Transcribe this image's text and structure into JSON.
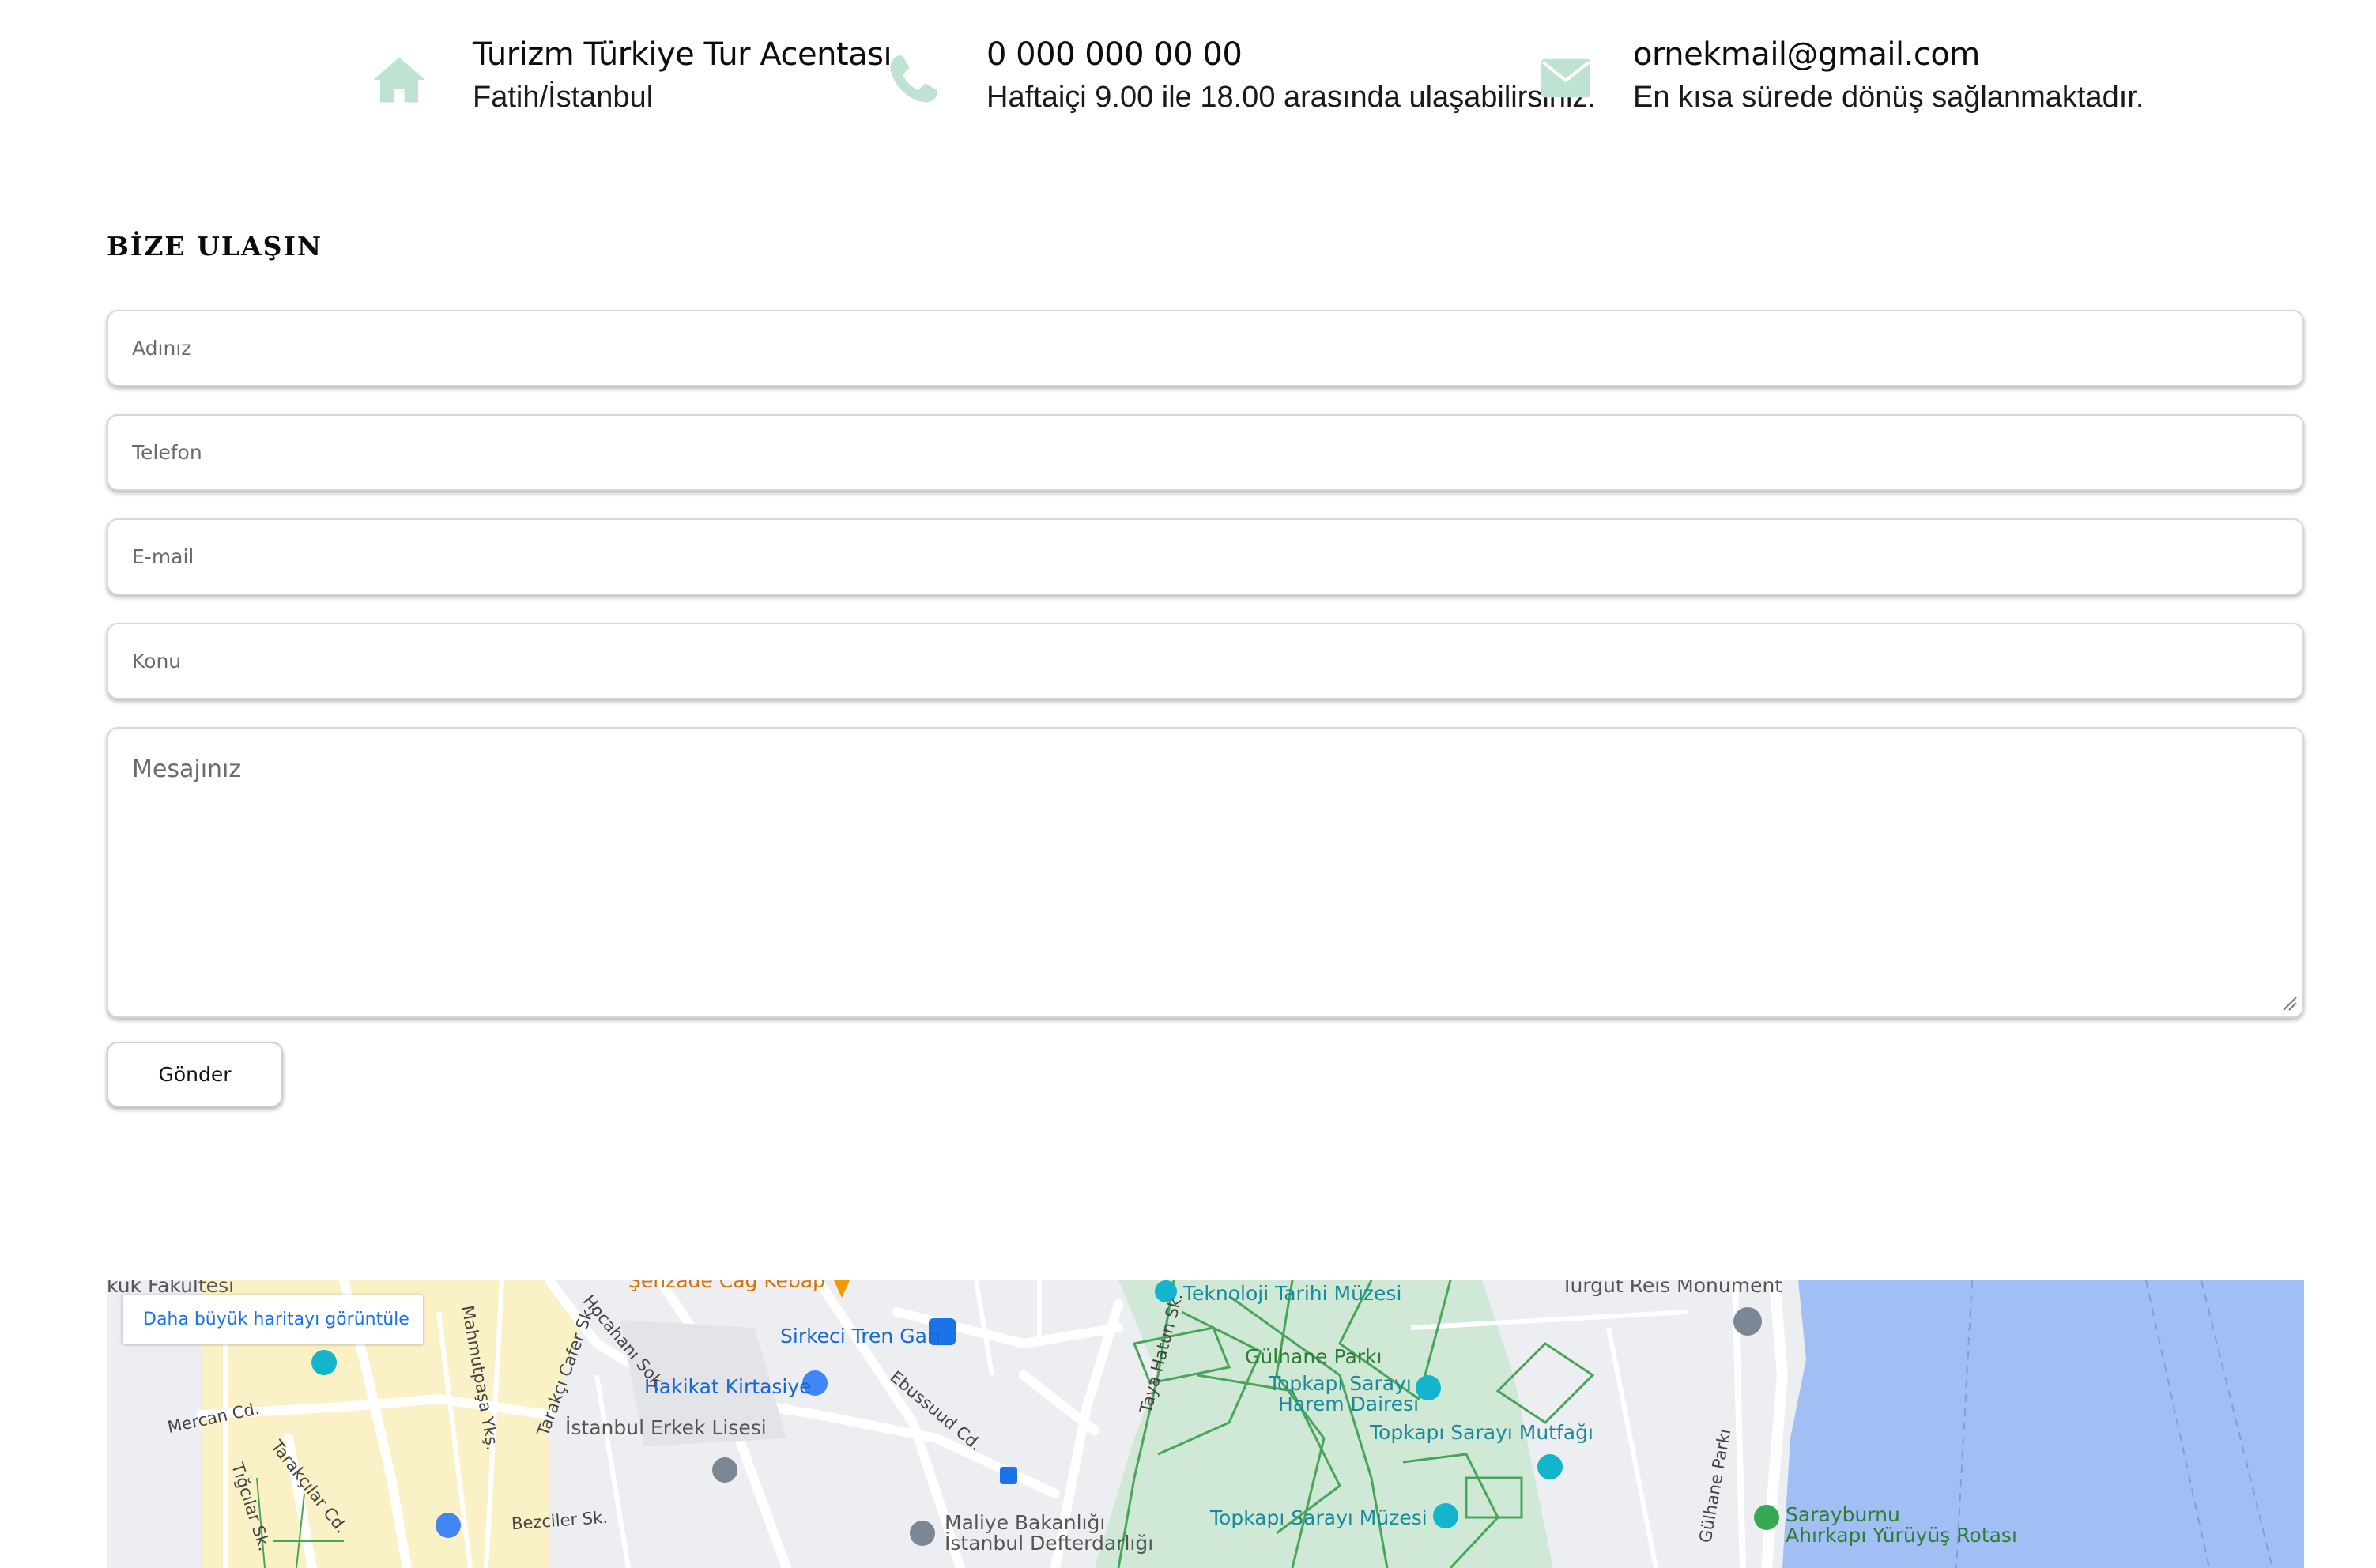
{
  "contact": {
    "address": {
      "icon": "home-icon",
      "title": "Turizm Türkiye Tur Acentası",
      "subtitle": "Fatih/İstanbul"
    },
    "phone": {
      "icon": "phone-icon",
      "title": "0 000 000 00 00",
      "subtitle": "Haftaiçi 9.00 ile 18.00 arasında ulaşabilirsiniz."
    },
    "email": {
      "icon": "envelope-icon",
      "title": "ornekmail@gmail.com",
      "subtitle": "En kısa sürede dönüş sağlanmaktadır."
    },
    "icon_color": "#bfe3d3"
  },
  "form": {
    "title": "BİZE ULAŞIN",
    "name_placeholder": "Adınız",
    "phone_placeholder": "Telefon",
    "email_placeholder": "E-mail",
    "subject_placeholder": "Konu",
    "message_placeholder": "Mesajınız",
    "submit_label": "Gönder"
  },
  "map": {
    "larger_map_link": "Daha büyük haritayı görüntüle",
    "poi": {
      "top_left_cut": "kuk Fakültesi",
      "top_kebab": "Şehzade Cağ Kebap",
      "teknoloji": "Teknoloji Tarihi Müzesi",
      "turgut": "Turgut Reis Monument",
      "sirkeci": "Sirkeci Tren Garı",
      "gulhane": "Gülhane Parkı",
      "hakikat": "Hakikat Kirtasiye",
      "harem_1": "Topkapı Sarayı",
      "harem_2": "Harem Dairesi",
      "erkek_lisesi": "İstanbul Erkek Lisesi",
      "mutfagi": "Topkapı Sarayı Mutfağı",
      "topkapi_muzesi": "Topkapı Sarayı Müzesi",
      "maliye_1": "Maliye Bakanlığı",
      "maliye_2": "İstanbul Defterdarlığı",
      "sarayburnu_1": "Sarayburnu",
      "sarayburnu_2": "Ahırkapı Yürüyüş Rotası"
    },
    "streets": {
      "mercan": "Mercan Cd.",
      "tigcilar": "Tığcılar Sk.",
      "tarakcilar": "Tarakçılar Cd.",
      "mahmutpasa": "Mahmutpaşa Ykş.",
      "tarakci_cafer": "Tarakçı Cafer Sk.",
      "hocahani": "Hocahanı Sok.",
      "ebussuud": "Ebussuud Cd.",
      "taya_hatun": "Taya Hatun Sk.",
      "bezciler": "Bezciler Sk.",
      "gulhane_parki": "Gülhane Parkı"
    },
    "colors": {
      "land": "#eceef1",
      "water": "#a1bff4",
      "park": "#cfe9d6",
      "park_line": "#4aa55a",
      "urban": "#fbf1c7"
    }
  }
}
